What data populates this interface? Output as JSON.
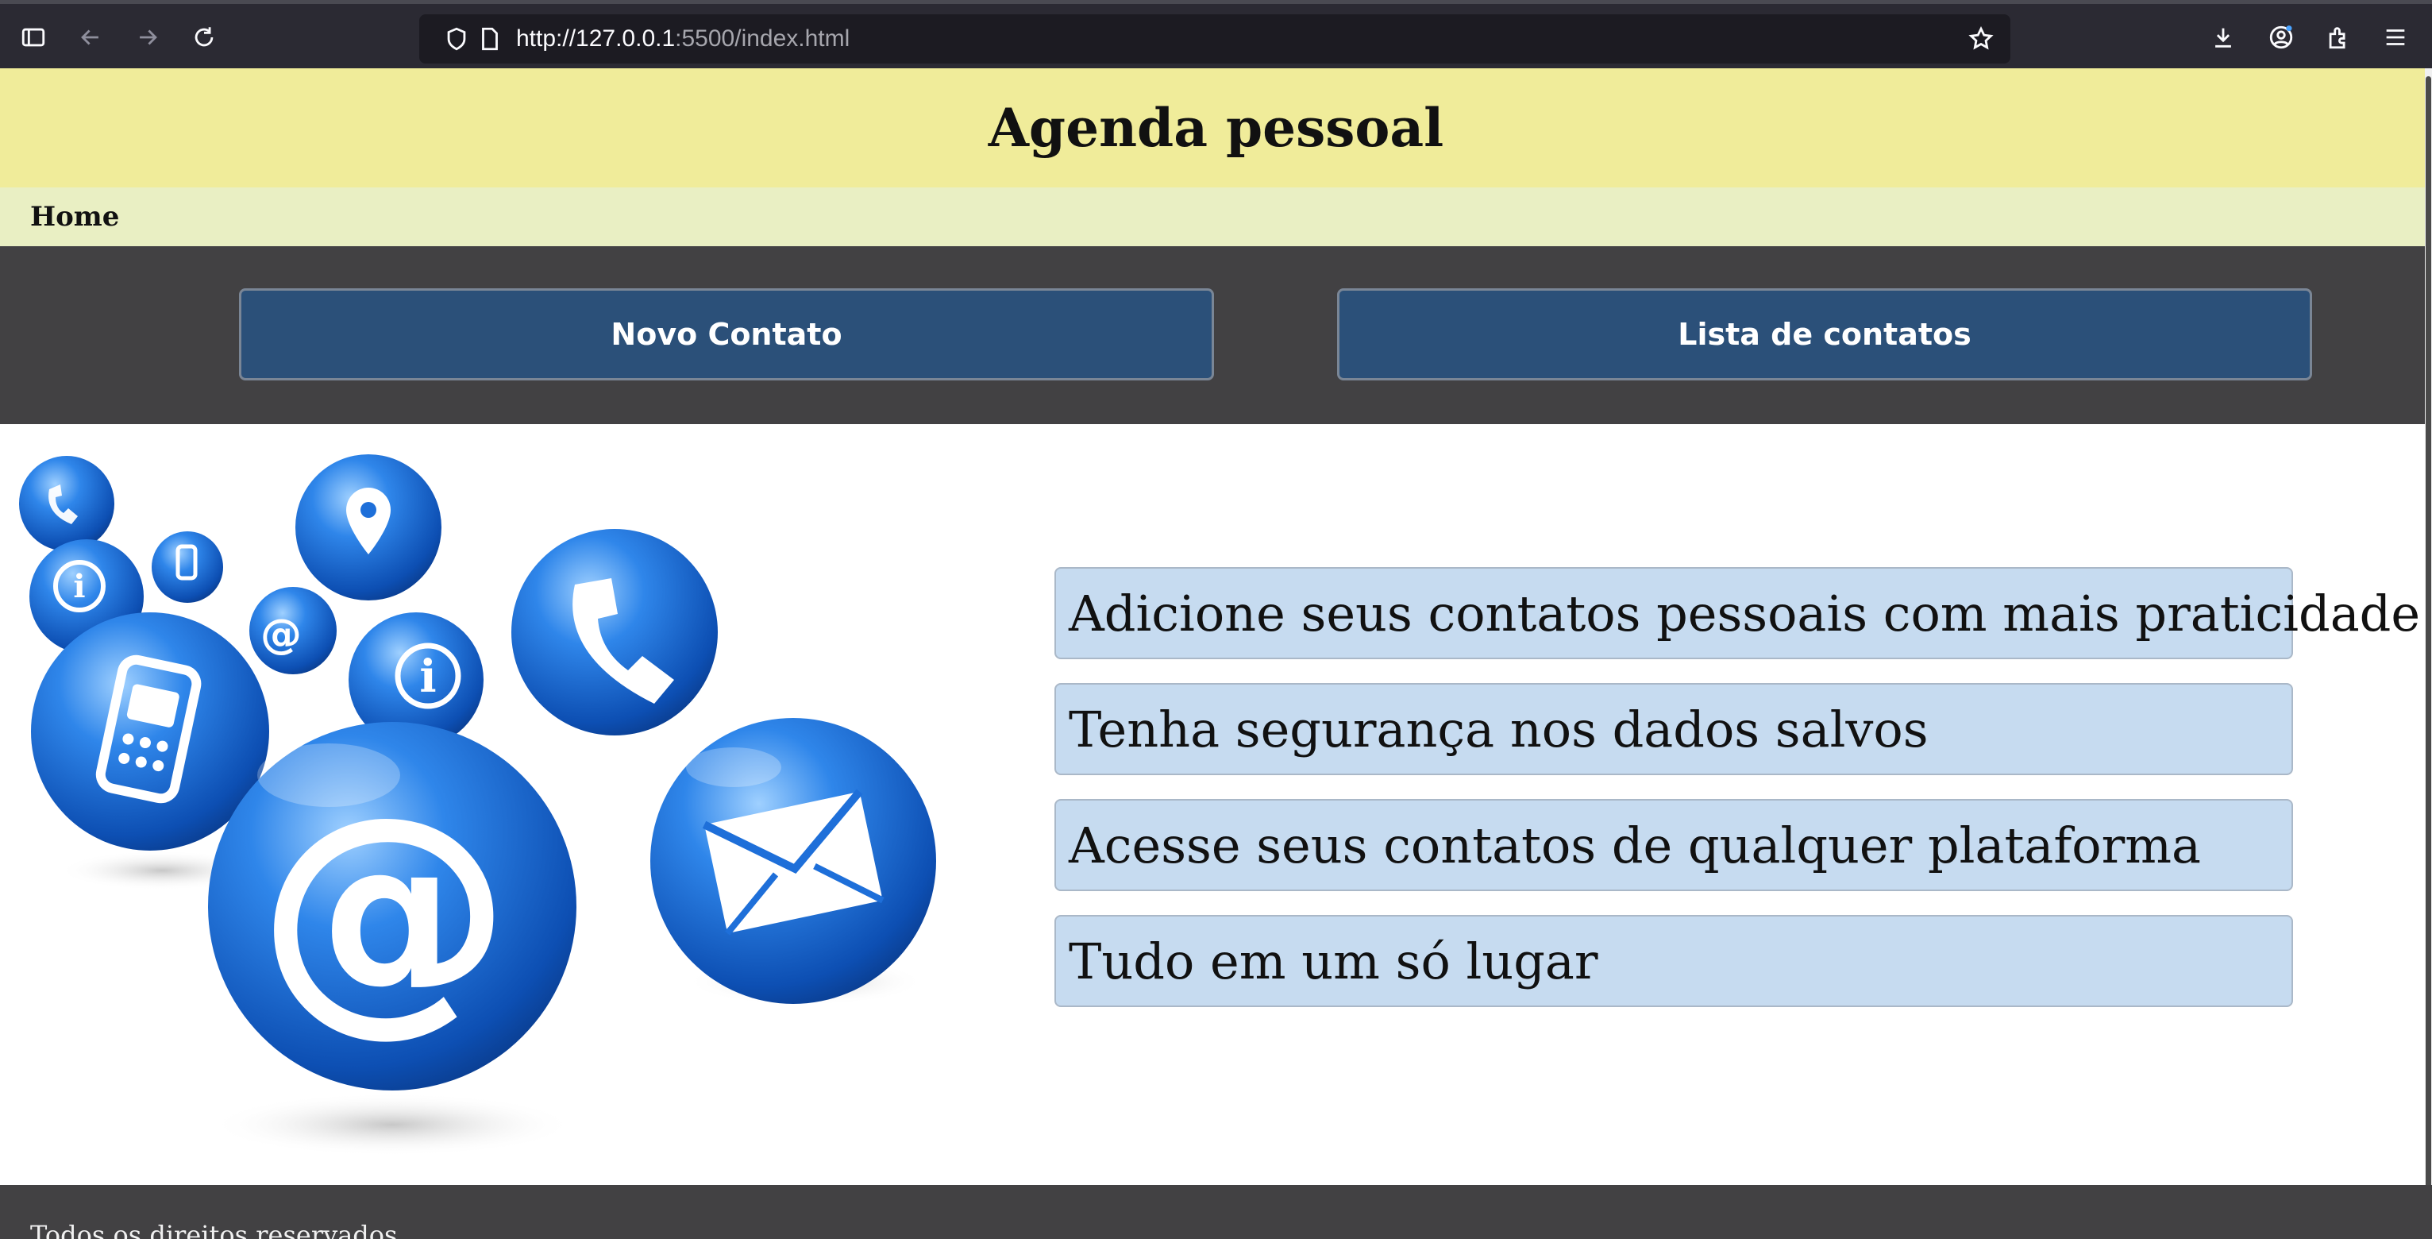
{
  "browser": {
    "url_host": "http://127.0.0.1",
    "url_rest": ":5500/index.html",
    "icons": [
      "sidebar-icon",
      "back-icon",
      "forward-icon",
      "reload-icon",
      "shield-icon",
      "page-icon",
      "star-icon",
      "download-icon",
      "account-icon",
      "extensions-icon",
      "menu-icon"
    ]
  },
  "header": {
    "title": "Agenda pessoal"
  },
  "nav": {
    "home": "Home"
  },
  "actions": {
    "new_contact": "Novo Contato",
    "contact_list": "Lista de contatos"
  },
  "features": [
    "Adicione seus contatos pessoais com mais praticidade",
    "Tenha segurança nos dados salvos",
    "Acesse seus contatos de qualquer plataforma",
    "Tudo em um só lugar"
  ],
  "footer": {
    "text": "Todos os direitos reservados"
  },
  "colors": {
    "header_bg": "#f0ec9a",
    "nav_bg": "#e9efc3",
    "action_bar_bg": "#424143",
    "button_bg": "#2b5079",
    "feature_bg": "#c6dbf0",
    "sphere_blue": "#1e6fd9"
  }
}
